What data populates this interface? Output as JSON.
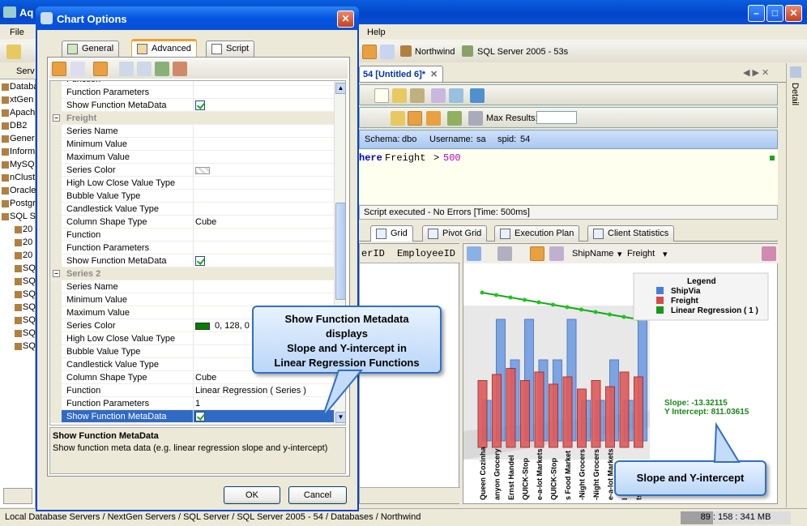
{
  "main_window": {
    "title": "Aq",
    "menu": [
      "File",
      "Help"
    ],
    "db_tabs": [
      "Northwind",
      "SQL Server 2005 - 53s"
    ],
    "doc_tab": "54 [Untitled 6]*",
    "detail_tab": "Detail",
    "max_results_label": "Max Results:",
    "schema_label": "Schema:",
    "schema_value": "dbo",
    "username_label": "Username:",
    "username_value": "sa",
    "spid_label": "spid:",
    "spid_value": "54",
    "sql_keyword": "here",
    "sql_field": "Freight",
    "sql_op": ">",
    "sql_value": "500",
    "script_status": "Script executed - No Errors [Time: 500ms]",
    "result_tabs": [
      "Grid",
      "Pivot Grid",
      "Execution Plan",
      "Client Statistics"
    ],
    "grid_columns": [
      "erID",
      "EmployeeID"
    ],
    "chart_toolbar": {
      "x_field": "ShipName",
      "y_field": "Freight"
    },
    "status_bar": "Local Database Servers / NextGen Servers / SQL Server / SQL Server 2005 - 54 / Databases / Northwind",
    "status_mem": "89 : 158 : 341 MB"
  },
  "tree": [
    "Databas",
    "xtGen S",
    "Apach",
    "DB2",
    "Gener",
    "Inform",
    "MySQ",
    "nClust",
    "Oracle",
    "Postgr",
    "SQL S",
    "20",
    "20",
    "20",
    "SQ",
    "SQ",
    "SQ",
    "SQ",
    "SQ",
    "SQ",
    "SQ"
  ],
  "dialog": {
    "title": "Chart Options",
    "tabs": [
      "General",
      "Advanced",
      "Script"
    ],
    "help_title": "Show Function MetaData",
    "help_text": "Show function meta data (e.g. linear regression slope and y-intercept)",
    "ok": "OK",
    "cancel": "Cancel"
  },
  "props": [
    {
      "name": "Function",
      "value": ""
    },
    {
      "name": "Function Parameters",
      "value": ""
    },
    {
      "name": "Show Function MetaData",
      "value": "check"
    },
    {
      "name": "Freight",
      "value": "",
      "cat": true
    },
    {
      "name": "Series Name",
      "value": ""
    },
    {
      "name": "Minimum Value",
      "value": ""
    },
    {
      "name": "Maximum Value",
      "value": ""
    },
    {
      "name": "Series Color",
      "value": "swatch"
    },
    {
      "name": "High Low Close Value Type",
      "value": ""
    },
    {
      "name": "Bubble Value Type",
      "value": ""
    },
    {
      "name": "Candlestick Value Type",
      "value": ""
    },
    {
      "name": "Column Shape Type",
      "value": "Cube"
    },
    {
      "name": "Function",
      "value": ""
    },
    {
      "name": "Function Parameters",
      "value": ""
    },
    {
      "name": "Show Function MetaData",
      "value": "check"
    },
    {
      "name": "Series 2",
      "value": "",
      "cat": true
    },
    {
      "name": "Series Name",
      "value": ""
    },
    {
      "name": "Minimum Value",
      "value": ""
    },
    {
      "name": "Maximum Value",
      "value": ""
    },
    {
      "name": "Series Color",
      "value": "0, 128, 0",
      "color": "#008000"
    },
    {
      "name": "High Low Close Value Type",
      "value": ""
    },
    {
      "name": "Bubble Value Type",
      "value": ""
    },
    {
      "name": "Candlestick Value Type",
      "value": ""
    },
    {
      "name": "Column Shape Type",
      "value": "Cube"
    },
    {
      "name": "Function",
      "value": "Linear Regression ( Series )"
    },
    {
      "name": "Function Parameters",
      "value": "1"
    },
    {
      "name": "Show Function MetaData",
      "value": "check",
      "selected": true
    }
  ],
  "callouts": {
    "metadata": [
      "Show Function Metadata",
      "displays",
      "Slope and Y-intercept in",
      "Linear Regression Functions"
    ],
    "slope": "Slope and Y-intercept"
  },
  "chart_data": {
    "type": "bar",
    "legend_title": "Legend",
    "legend": [
      {
        "name": "ShipVia",
        "color": "#4a7fd8"
      },
      {
        "name": "Freight",
        "color": "#d84a4a"
      },
      {
        "name": "Linear Regression ( 1 )",
        "color": "#189818"
      }
    ],
    "categories": [
      "Queen Cozinha",
      "anyon Grocery",
      "Ernst Handel",
      "QUICK-Stop",
      "e-a-lot Markets",
      "QUICK-Stop",
      "s Food Market",
      "-Night Grocers",
      "-Night Grocers",
      "e-a-lot Markets",
      "l Handel",
      "ts"
    ],
    "series": [
      {
        "name": "ShipVia",
        "values": [
          1,
          3,
          2,
          3,
          2,
          2,
          3,
          1,
          1,
          2,
          1,
          3
        ]
      },
      {
        "name": "Freight",
        "values": [
          0.55,
          0.6,
          0.65,
          0.55,
          0.62,
          0.52,
          0.58,
          0.48,
          0.55,
          0.5,
          0.62,
          0.58
        ]
      }
    ],
    "slope_text": "Slope: -13.32115",
    "intercept_text": "Y Intercept: 811.03615"
  }
}
